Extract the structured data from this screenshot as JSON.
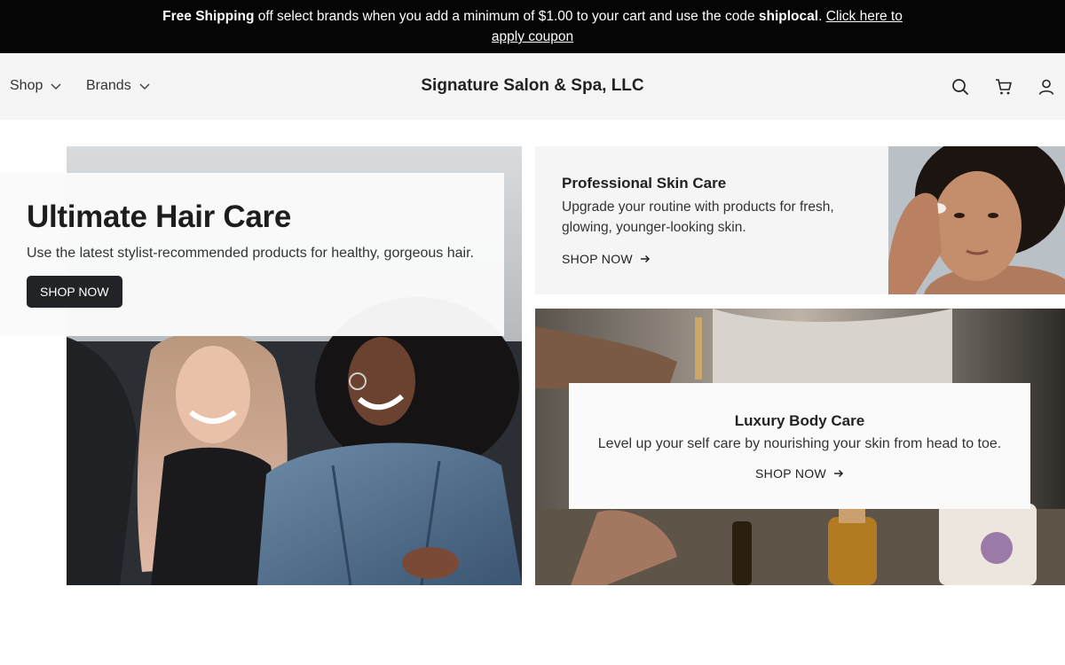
{
  "announcement": {
    "bold_lead": "Free Shipping",
    "text_middle": " off select brands when you add a minimum of $1.00 to your cart and use the code ",
    "code": "shiplocal",
    "period": ". ",
    "link": "Click here to apply coupon"
  },
  "header": {
    "nav": [
      {
        "label": "Shop"
      },
      {
        "label": "Brands"
      }
    ],
    "title": "Signature Salon & Spa, LLC",
    "icons": [
      "search-icon",
      "cart-icon",
      "account-icon"
    ]
  },
  "hero": {
    "title": "Ultimate Hair Care",
    "description": "Use the latest stylist-recommended products for healthy, gorgeous hair.",
    "button": "SHOP NOW"
  },
  "skin": {
    "title": "Professional Skin Care",
    "description": "Upgrade your routine with products for fresh, glowing, younger-looking skin.",
    "link": "SHOP NOW"
  },
  "body": {
    "title": "Luxury Body Care",
    "description": "Level up your self care by nourishing your skin from head to toe.",
    "link": "SHOP NOW"
  },
  "colors": {
    "announcement_bg": "#050505",
    "header_bg": "#f5f5f5",
    "button_dark": "#222327"
  }
}
